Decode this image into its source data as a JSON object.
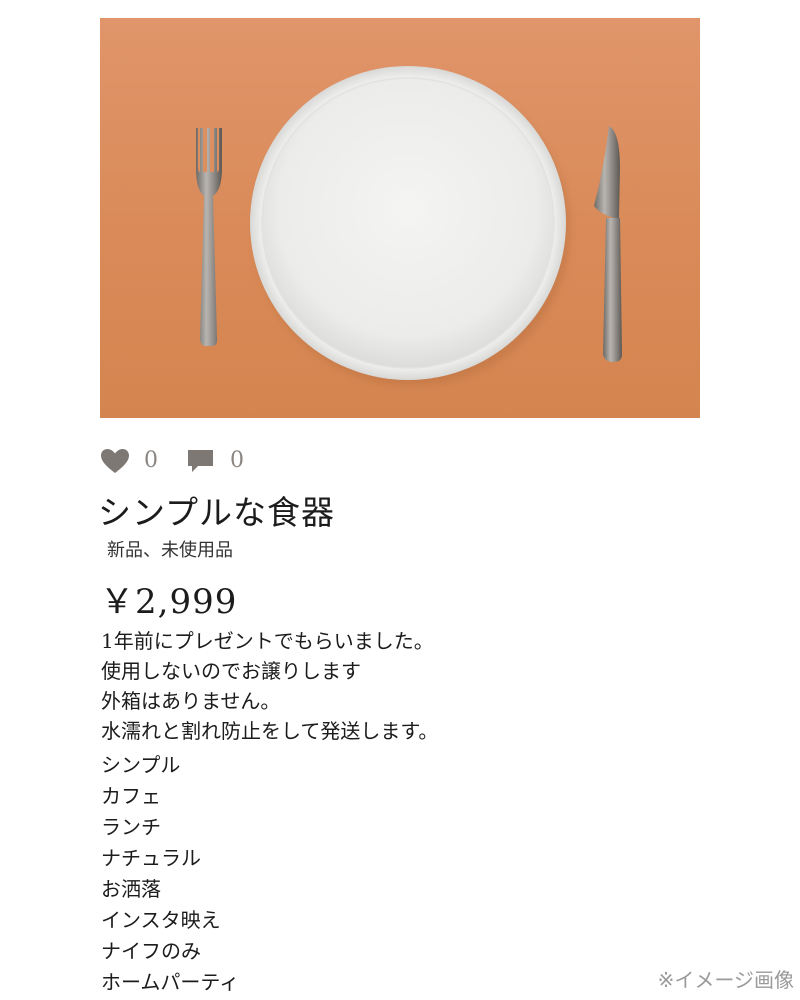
{
  "photo": {
    "icon": "plate-with-fork-and-knife-photo",
    "background_color": "#d98c59"
  },
  "likes": {
    "icon": "heart-icon",
    "count": "0"
  },
  "comments": {
    "icon": "comment-icon",
    "count": "0"
  },
  "product": {
    "title": "シンプルな食器",
    "condition": "新品、未使用品",
    "price": "￥2,999"
  },
  "description": [
    "1年前にプレゼントでもらいました。",
    "使用しないのでお譲りします",
    "外箱はありません。",
    "水濡れと割れ防止をして発送します。"
  ],
  "tags": [
    "シンプル",
    "カフェ",
    "ランチ",
    "ナチュラル",
    "お洒落",
    "インスタ映え",
    "ナイフのみ",
    "ホームパーティ"
  ],
  "note": "※イメージ画像",
  "colors": {
    "icon_gray": "#7d7874",
    "count_gray": "#8a8580"
  }
}
